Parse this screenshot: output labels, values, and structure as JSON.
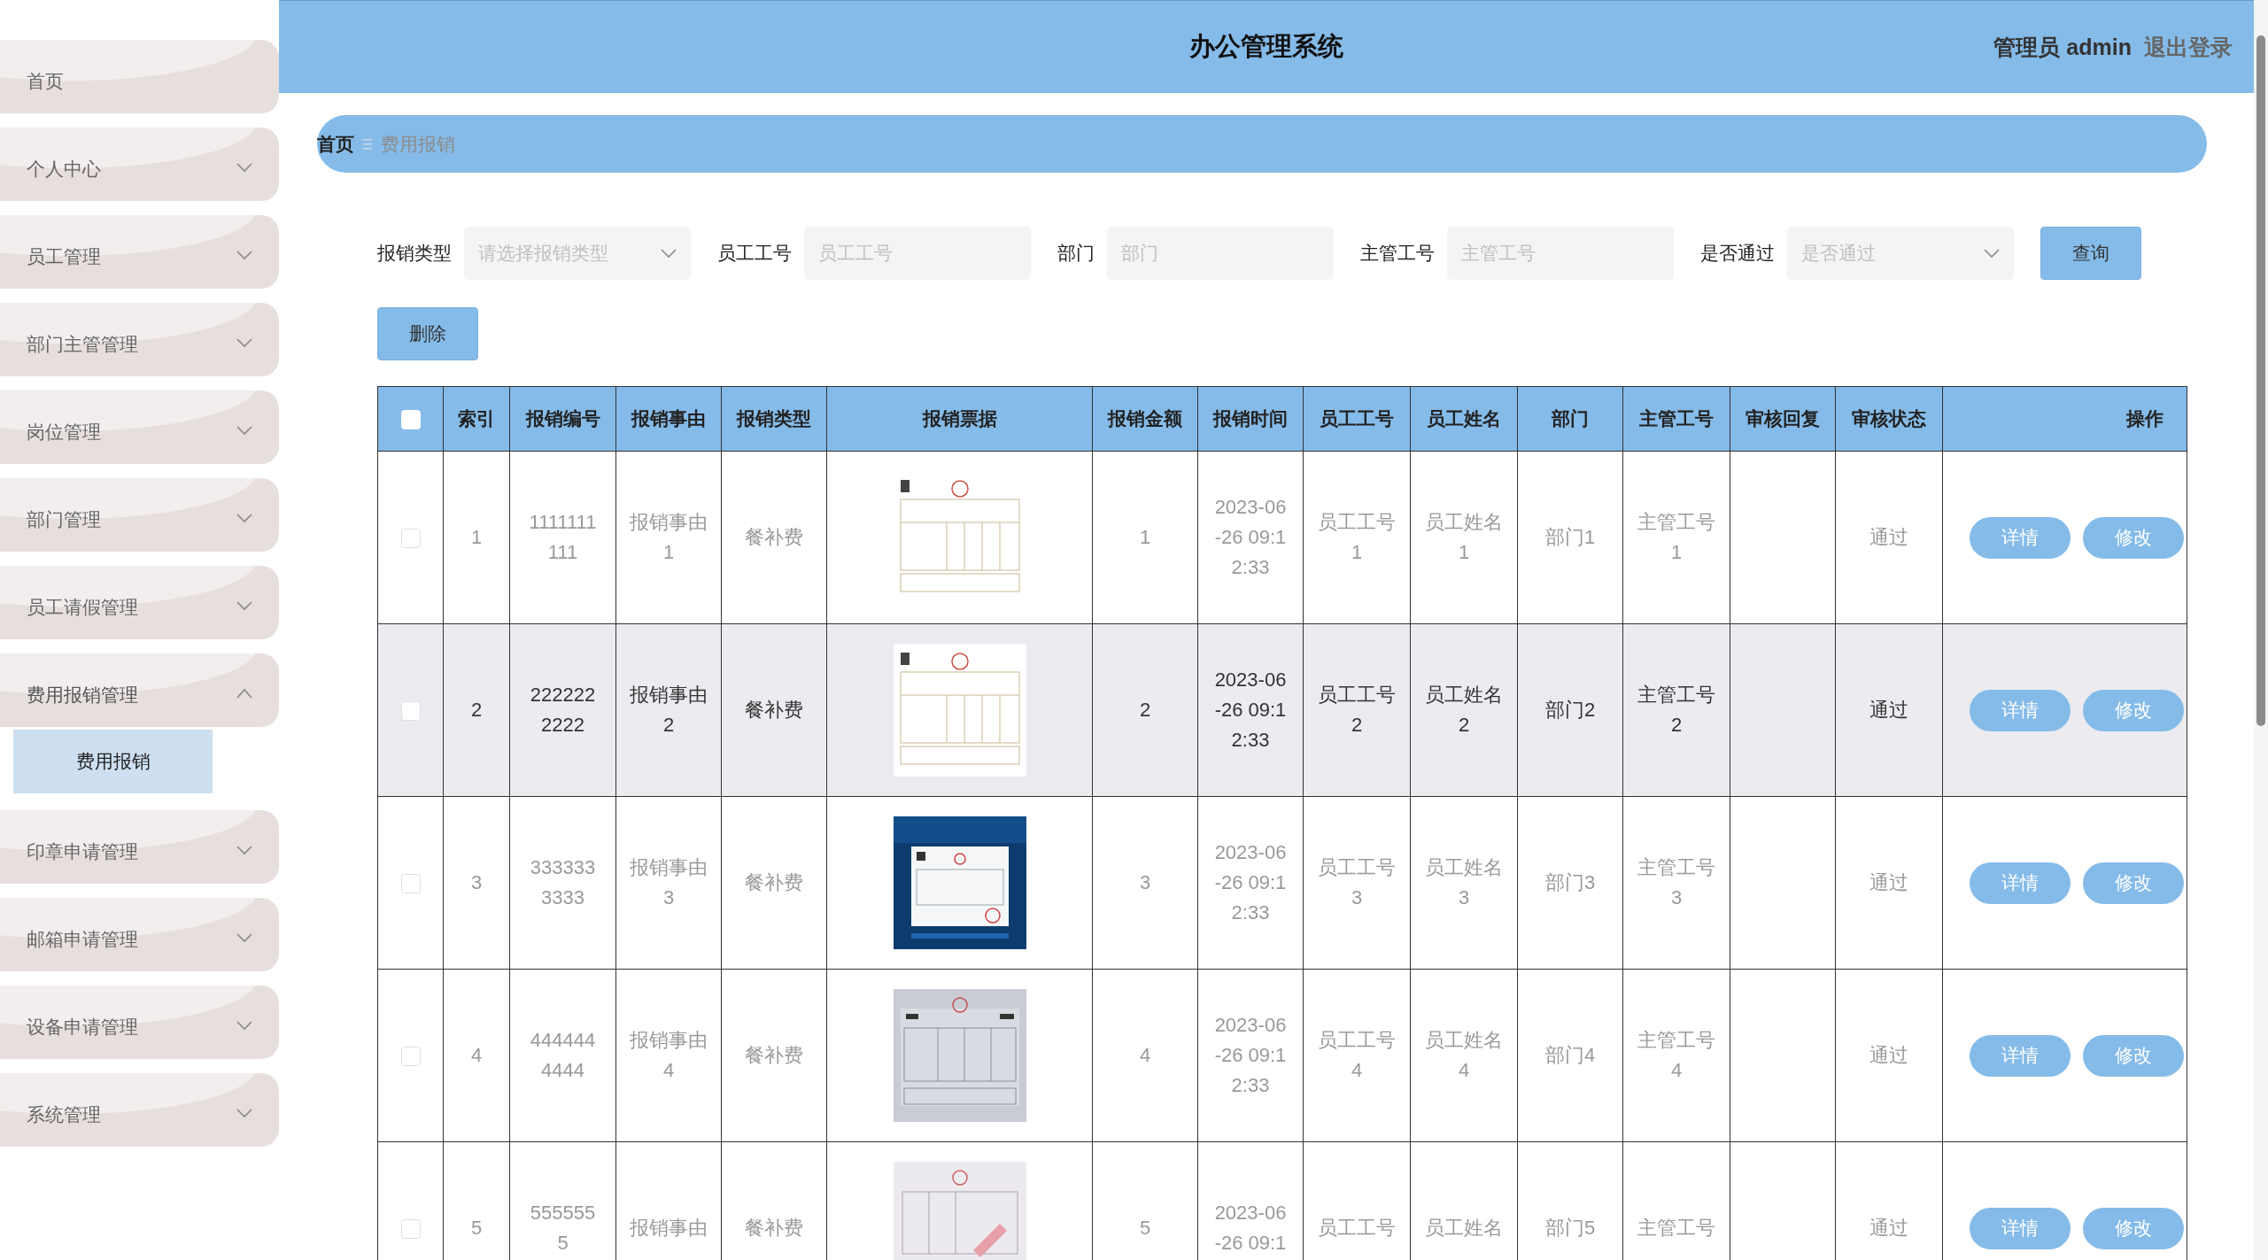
{
  "header": {
    "title": "办公管理系统",
    "user": "管理员 admin",
    "logout": "退出登录"
  },
  "sidebar": {
    "items": [
      {
        "label": "首页",
        "expandable": false,
        "expanded": false
      },
      {
        "label": "个人中心",
        "expandable": true,
        "expanded": false
      },
      {
        "label": "员工管理",
        "expandable": true,
        "expanded": false
      },
      {
        "label": "部门主管管理",
        "expandable": true,
        "expanded": false
      },
      {
        "label": "岗位管理",
        "expandable": true,
        "expanded": false
      },
      {
        "label": "部门管理",
        "expandable": true,
        "expanded": false
      },
      {
        "label": "员工请假管理",
        "expandable": true,
        "expanded": false
      },
      {
        "label": "费用报销管理",
        "expandable": true,
        "expanded": true,
        "children": [
          {
            "label": "费用报销",
            "selected": true
          }
        ]
      },
      {
        "label": "印章申请管理",
        "expandable": true,
        "expanded": false
      },
      {
        "label": "邮箱申请管理",
        "expandable": true,
        "expanded": false
      },
      {
        "label": "设备申请管理",
        "expandable": true,
        "expanded": false
      },
      {
        "label": "系统管理",
        "expandable": true,
        "expanded": false
      }
    ]
  },
  "breadcrumb": [
    "首页",
    "费用报销"
  ],
  "filters": [
    {
      "label": "报销类型",
      "kind": "select",
      "placeholder": "请选择报销类型"
    },
    {
      "label": "员工工号",
      "kind": "input",
      "placeholder": "员工工号"
    },
    {
      "label": "部门",
      "kind": "input",
      "placeholder": "部门"
    },
    {
      "label": "主管工号",
      "kind": "input",
      "placeholder": "主管工号"
    },
    {
      "label": "是否通过",
      "kind": "select",
      "placeholder": "是否通过"
    }
  ],
  "search_button": "查询",
  "delete_button": "删除",
  "table": {
    "select_all": {
      "checked": false
    },
    "columns": [
      "索引",
      "报销编号",
      "报销事由",
      "报销类型",
      "报销票据",
      "报销金额",
      "报销时间",
      "员工工号",
      "员工姓名",
      "部门",
      "主管工号",
      "审核回复",
      "审核状态",
      "操作"
    ],
    "rows": [
      {
        "checked": false,
        "highlighted": false,
        "index": "1",
        "number": "1111111111",
        "reason": "报销事由1",
        "type": "餐补费",
        "amount": "1",
        "time": "2023-06-26 09:12:33",
        "employee_no": "员工工号1",
        "employee_name": "员工姓名1",
        "department": "部门1",
        "supervisor_no": "主管工号1",
        "status": "通过",
        "actions": [
          "详情",
          "修改"
        ]
      },
      {
        "checked": false,
        "highlighted": true,
        "index": "2",
        "number": "2222222222",
        "reason": "报销事由2",
        "type": "餐补费",
        "amount": "2",
        "time": "2023-06-26 09:12:33",
        "employee_no": "员工工号2",
        "employee_name": "员工姓名2",
        "department": "部门2",
        "supervisor_no": "主管工号2",
        "status": "通过",
        "actions": [
          "详情",
          "修改"
        ]
      },
      {
        "checked": false,
        "highlighted": false,
        "index": "3",
        "number": "3333333333",
        "reason": "报销事由3",
        "type": "餐补费",
        "amount": "3",
        "time": "2023-06-26 09:12:33",
        "employee_no": "员工工号3",
        "employee_name": "员工姓名3",
        "department": "部门3",
        "supervisor_no": "主管工号3",
        "status": "通过",
        "actions": [
          "详情",
          "修改"
        ]
      },
      {
        "checked": false,
        "highlighted": false,
        "index": "4",
        "number": "4444444444",
        "reason": "报销事由4",
        "type": "餐补费",
        "amount": "4",
        "time": "2023-06-26 09:12:33",
        "employee_no": "员工工号4",
        "employee_name": "员工姓名4",
        "department": "部门4",
        "supervisor_no": "主管工号4",
        "status": "通过",
        "actions": [
          "详情",
          "修改"
        ]
      },
      {
        "checked": false,
        "highlighted": false,
        "index": "5",
        "number": "5555555",
        "reason": "报销事由",
        "type": "餐补费",
        "amount": "5",
        "time": "2023-06-26 09:1",
        "employee_no": "员工工号",
        "employee_name": "员工姓名",
        "department": "部门5",
        "supervisor_no": "主管工号",
        "status": "通过",
        "actions": [
          "详情",
          "修改"
        ]
      }
    ]
  }
}
